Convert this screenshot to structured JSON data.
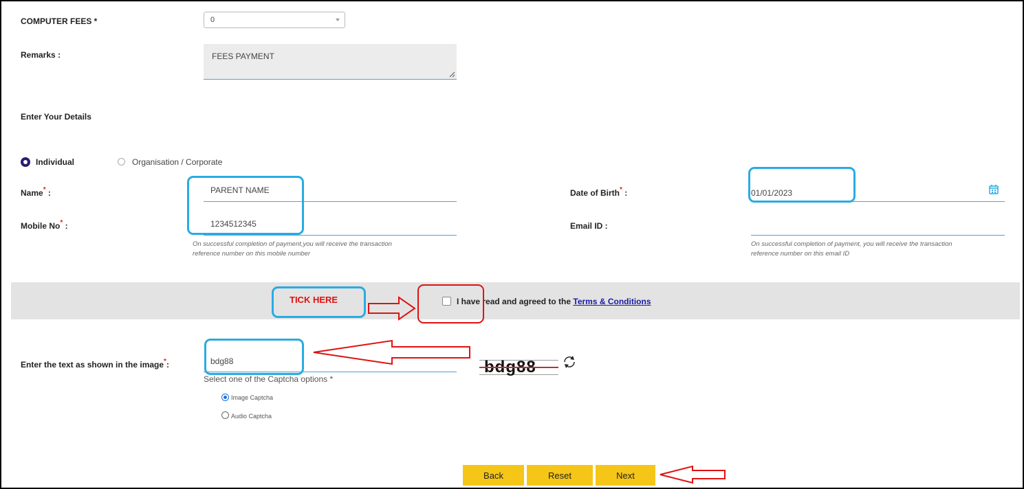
{
  "fees": {
    "label": "COMPUTER FEES *",
    "value": "0"
  },
  "remarks": {
    "label": "Remarks :",
    "value": "FEES PAYMENT"
  },
  "details_heading": "Enter Your Details",
  "type_options": {
    "individual": "Individual",
    "organisation": "Organisation / Corporate"
  },
  "name": {
    "label": "Name",
    "value": "PARENT NAME"
  },
  "dob": {
    "label": "Date of Birth",
    "value": "01/01/2023"
  },
  "mobile": {
    "label": "Mobile No",
    "value": "1234512345",
    "hint_line1": "On successful completion of payment,you will receive the transaction",
    "hint_line2": "reference number on this mobile number"
  },
  "email": {
    "label": "Email ID :",
    "value": "",
    "hint_line1": "On successful completion of payment, you will receive the transaction",
    "hint_line2": "reference number on this email ID"
  },
  "terms": {
    "prefix": "I have read and agreed to the ",
    "link": "Terms & Conditions"
  },
  "annotation": {
    "tick_here": "TICK HERE"
  },
  "captcha": {
    "label": "Enter the text as shown in the image",
    "value": "bdg88",
    "image_text": "bdg88",
    "options_label": "Select one of the Captcha options *",
    "image_option": "Image Captcha",
    "audio_option": "Audio Captcha"
  },
  "buttons": {
    "back": "Back",
    "reset": "Reset",
    "next": "Next"
  },
  "colors": {
    "accent": "#29abe2",
    "button": "#f5c518",
    "annotation": "#e01010",
    "band": "#e3e3e3"
  }
}
